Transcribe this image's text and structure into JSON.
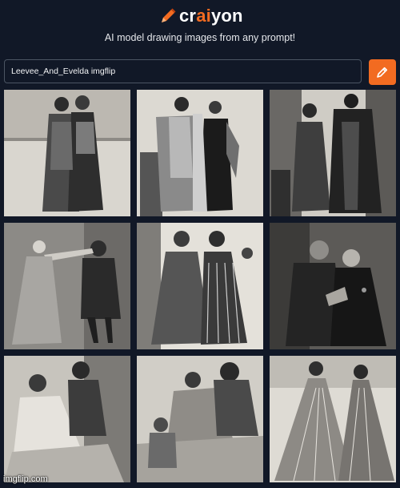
{
  "brand": {
    "name_part1": "cr",
    "name_part2": "ai",
    "name_part3": "yon",
    "accent": "#f26b21"
  },
  "tagline": "AI model drawing images from any prompt!",
  "prompt": {
    "value": "Leevee_And_Evelda imgflip"
  },
  "generate_button": {
    "icon": "pencil-icon"
  },
  "grid": {
    "images": [
      {
        "alt": "Victorian illustration of two women standing"
      },
      {
        "alt": "Victorian illustration of two women in gowns"
      },
      {
        "alt": "Victorian illustration of a woman and a cloaked figure"
      },
      {
        "alt": "Victorian illustration of a woman gesturing to a figure"
      },
      {
        "alt": "Victorian illustration of two women in striped dresses"
      },
      {
        "alt": "Victorian illustration of two women in dark dresses"
      },
      {
        "alt": "Victorian illustration of a seated woman and a companion"
      },
      {
        "alt": "Victorian illustration of women with a child"
      },
      {
        "alt": "Victorian illustration of two women in wide skirts"
      }
    ]
  },
  "watermark": "imgflip.com"
}
